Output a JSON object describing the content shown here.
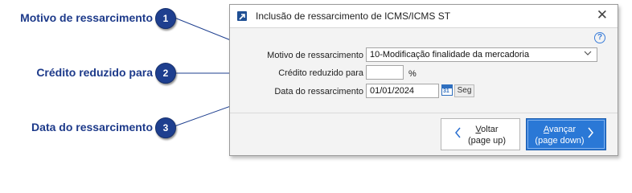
{
  "callouts": [
    {
      "number": "1",
      "label": "Motivo de ressarcimento"
    },
    {
      "number": "2",
      "label": "Crédito reduzido para"
    },
    {
      "number": "3",
      "label": "Data do ressarcimento"
    }
  ],
  "dialog": {
    "title": "Inclusão de ressarcimento de ICMS/ICMS ST",
    "close_glyph": "✕",
    "help_glyph": "?",
    "fields": {
      "motivo": {
        "label": "Motivo de ressarcimento",
        "value": "10-Modificação finalidade da mercadoria"
      },
      "credito": {
        "label": "Crédito reduzido para",
        "value": "",
        "unit": "%"
      },
      "data": {
        "label": "Data do ressarcimento",
        "value": "01/01/2024",
        "calendar_day": "31",
        "weekday": "Seg"
      }
    },
    "buttons": {
      "back": {
        "line1": "Voltar",
        "line2": "(page up)",
        "arrow": "‹"
      },
      "next": {
        "line1": "Avançar",
        "line2": "(page down)",
        "arrow": "›"
      }
    }
  },
  "colors": {
    "badge": "#1e3f8f",
    "callout_text": "#1d3a8a",
    "primary_button": "#2a78d6"
  },
  "icons": [
    "app-icon",
    "close-icon",
    "help-icon",
    "chevron-down-icon",
    "calendar-icon",
    "chevron-left-icon",
    "chevron-right-icon"
  ]
}
